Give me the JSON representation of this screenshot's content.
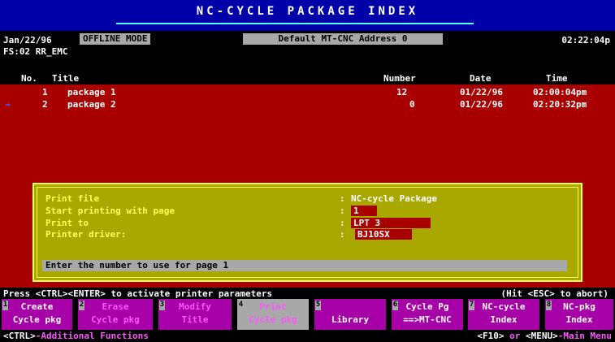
{
  "title": "NC-CYCLE PACKAGE INDEX",
  "status": {
    "date": "Jan/22/96",
    "mode": "OFFLINE MODE",
    "address": "Default MT-CNC Address 0",
    "clock": "02:22:04p",
    "fs_line": "FS:02 RR_EMC"
  },
  "columns": {
    "no": "No.",
    "title": "Title",
    "number": "Number",
    "date": "Date",
    "time": "Time"
  },
  "rows": [
    {
      "no": "1",
      "title": "package 1",
      "number": "12",
      "date": "01/22/96",
      "time": "02:00:04pm",
      "selected": false
    },
    {
      "no": "2",
      "title": "package 2",
      "number": "0",
      "date": "01/22/96",
      "time": "02:20:32pm",
      "selected": true
    }
  ],
  "selected_marker": "→",
  "dialog": {
    "print_file_label": "Print file",
    "print_file_value": "NC-cycle Package",
    "start_page_label": "Start printing with page",
    "start_page_value": "1",
    "print_to_label": "Print to",
    "print_to_value": "LPT 3",
    "printer_driver_label": "Printer driver:",
    "printer_driver_value": "BJ10SX",
    "colon": ":",
    "prompt": "Enter the number to use for page 1"
  },
  "helpline": {
    "left": "Press <CTRL><ENTER> to activate printer parameters",
    "right": "(Hit <ESC> to abort)"
  },
  "fkeys": [
    {
      "num": "1",
      "line1": "Create",
      "line2": "Cycle pkg",
      "style": "normal"
    },
    {
      "num": "2",
      "line1": "Erase",
      "line2": "Cycle pkg",
      "style": "dim"
    },
    {
      "num": "3",
      "line1": "Modify",
      "line2": "Title",
      "style": "dim"
    },
    {
      "num": "4",
      "line1": "Print",
      "line2": "Cycle pkg",
      "style": "gray"
    },
    {
      "num": "5",
      "line1": "",
      "line2": "Library",
      "style": "normal"
    },
    {
      "num": "6",
      "line1": "Cycle Pg",
      "line2": "==>MT-CNC",
      "style": "normal"
    },
    {
      "num": "7",
      "line1": "NC-cycle",
      "line2": "Index",
      "style": "normal"
    },
    {
      "num": "8",
      "line1": "NC-pkg",
      "line2": "Index",
      "style": "normal"
    }
  ],
  "bottom": {
    "ctrl_key": "<CTRL>",
    "ctrl_text": "-Additional Functions",
    "f10_key": "<F10>",
    "or": "or",
    "menu_key": "<MENU>",
    "menu_text": "-Main Menu"
  },
  "colors": {
    "title_bar": "#0000a8",
    "list_background": "#a80000",
    "dialog_background": "#a8a800",
    "fkey_background": "#a800a8",
    "gray": "#a8a8a8"
  }
}
